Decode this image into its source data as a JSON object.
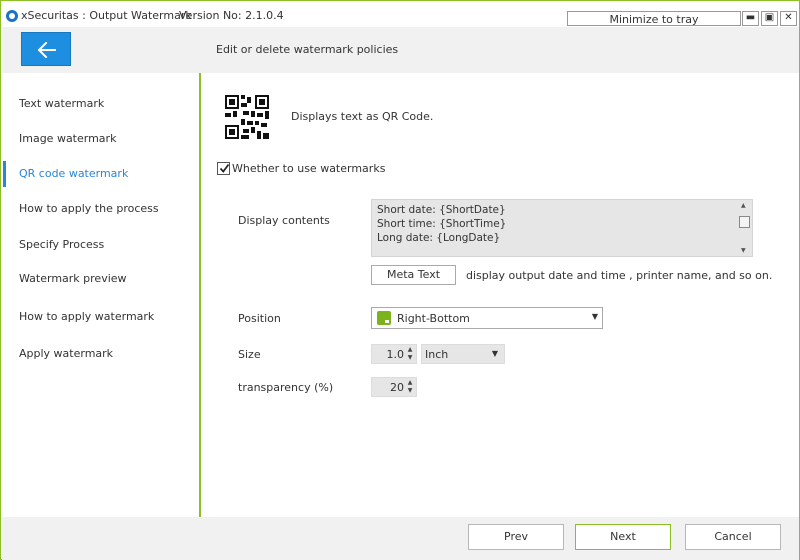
{
  "window": {
    "title": "xSecuritas : Output Watermark",
    "version": "Version No: 2.1.0.4",
    "tray_label": "Minimize to tray",
    "min_glyph": "▬",
    "max_glyph": "▣",
    "close_glyph": "✕"
  },
  "header": {
    "title": "Edit or delete watermark policies"
  },
  "sidebar": {
    "items": [
      {
        "label": "Text watermark"
      },
      {
        "label": "Image watermark"
      },
      {
        "label": "QR code watermark",
        "active": true
      },
      {
        "label": "How to apply the process"
      },
      {
        "label": "Specify Process"
      },
      {
        "label": "Watermark preview"
      },
      {
        "label": "How to apply watermark"
      },
      {
        "label": "Apply watermark"
      }
    ]
  },
  "main": {
    "description": "Displays text as QR Code.",
    "use_watermark": {
      "label": "Whether to use watermarks",
      "checked": true
    },
    "display_contents": {
      "label": "Display contents",
      "lines": [
        "Short date: {ShortDate}",
        "Short time: {ShortTime}",
        "Long date: {LongDate}"
      ]
    },
    "meta_text": {
      "button_label": "Meta Text",
      "description": "display output date and time , printer name, and so on."
    },
    "position": {
      "label": "Position",
      "value": "Right-Bottom"
    },
    "size": {
      "label": "Size",
      "value": "1.0",
      "unit": "Inch"
    },
    "transparency": {
      "label": "transparency (%)",
      "value": "20"
    }
  },
  "footer": {
    "prev_label": "Prev",
    "next_label": "Next",
    "cancel_label": "Cancel"
  },
  "colors": {
    "accent_green": "#8cbf26",
    "accent_blue": "#1e8ee0",
    "active_nav": "#2a86d6"
  }
}
